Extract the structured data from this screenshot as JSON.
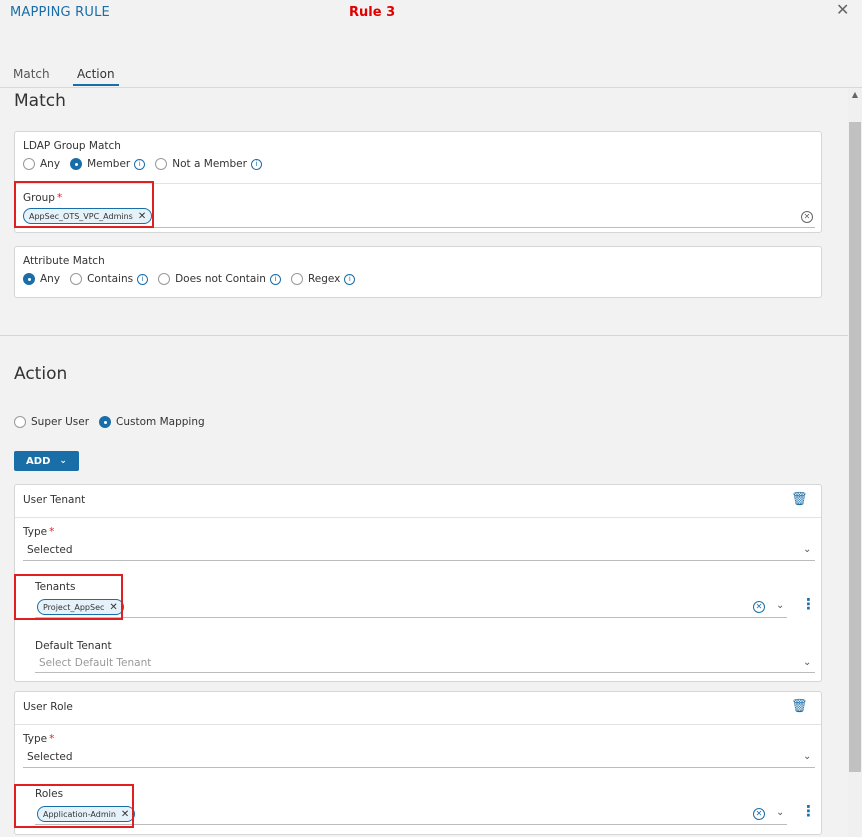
{
  "header": {
    "title": "MAPPING RULE",
    "rule_label": "Rule 3",
    "close_glyph": "✕"
  },
  "tabs": [
    {
      "label": "Match",
      "active": false
    },
    {
      "label": "Action",
      "active": true
    }
  ],
  "match": {
    "heading": "Match",
    "ldap": {
      "label": "LDAP Group Match",
      "options": [
        "Any",
        "Member",
        "Not a Member"
      ],
      "selected": "Member"
    },
    "group": {
      "label": "Group",
      "chips": [
        "AppSec_OTS_VPC_Admins"
      ]
    },
    "attribute": {
      "label": "Attribute Match",
      "options": [
        "Any",
        "Contains",
        "Does not Contain",
        "Regex"
      ],
      "selected": "Any"
    }
  },
  "action": {
    "heading": "Action",
    "mode_options": [
      "Super User",
      "Custom Mapping"
    ],
    "mode_selected": "Custom Mapping",
    "add_label": "ADD",
    "user_tenant": {
      "title": "User Tenant",
      "type_label": "Type",
      "type_value": "Selected",
      "tenants_label": "Tenants",
      "tenants_chips": [
        "Project_AppSec"
      ],
      "default_tenant_label": "Default Tenant",
      "default_tenant_placeholder": "Select Default Tenant"
    },
    "user_role": {
      "title": "User Role",
      "type_label": "Type",
      "type_value": "Selected",
      "roles_label": "Roles",
      "roles_chips": [
        "Application-Admin"
      ]
    }
  },
  "colors": {
    "accent": "#1a6ea8",
    "highlight": "#e02020",
    "rule_label": "#e00000"
  }
}
